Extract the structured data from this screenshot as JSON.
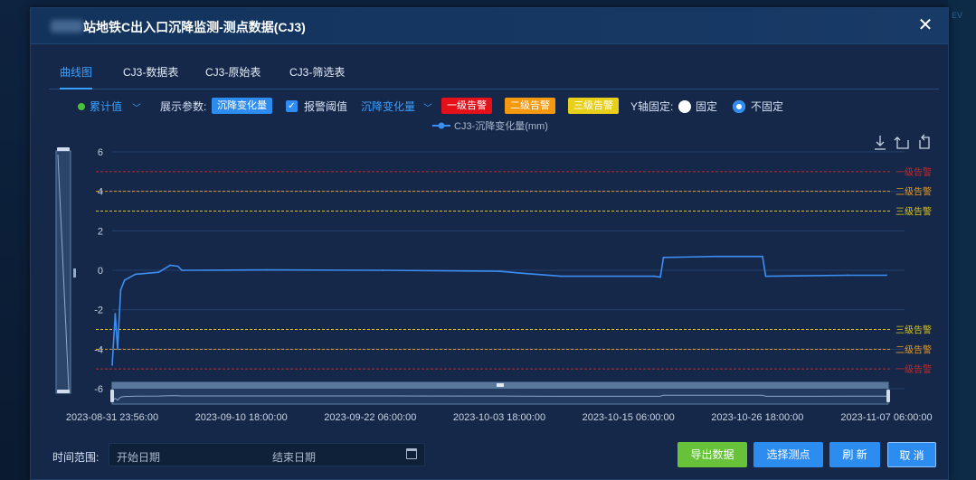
{
  "background": {
    "corner_text": "EV"
  },
  "dialog": {
    "title": "站地铁C出入口沉降监测-测点数据(CJ3)",
    "close_glyph": "✕"
  },
  "tabs": [
    {
      "label": "曲线图",
      "active": true
    },
    {
      "label": "CJ3-数据表",
      "active": false
    },
    {
      "label": "CJ3-原始表",
      "active": false
    },
    {
      "label": "CJ3-筛选表",
      "active": false
    }
  ],
  "toolbar": {
    "value_select": "累计值",
    "display_param_label": "展示参数:",
    "display_param_value": "沉降变化量",
    "alarm_checkbox_label": "报警阈值",
    "alarm_select": "沉降变化量",
    "alarm_tags": [
      {
        "label": "一级告警",
        "color": "#e5111a"
      },
      {
        "label": "二级告警",
        "color": "#f59a0e"
      },
      {
        "label": "三级告警",
        "color": "#e8d01a"
      }
    ],
    "y_axis_label": "Y轴固定:",
    "radio_fixed": "固定",
    "radio_not_fixed": "不固定"
  },
  "chart_data": {
    "type": "line",
    "legend": "CJ3-沉降变化量(mm)",
    "y_ticks": [
      "6",
      "4",
      "2",
      "0",
      "-2",
      "-4",
      "-6"
    ],
    "ylim": [
      -6,
      6
    ],
    "x_tick_labels": [
      "2023-08-31 23:56:00",
      "2023-09-10 18:00:00",
      "2023-09-22 06:00:00",
      "2023-10-03 18:00:00",
      "2023-10-15 06:00:00",
      "2023-10-26 18:00:00",
      "2023-11-07 06:00:00"
    ],
    "thresholds": [
      {
        "label": "一级告警",
        "value": 5,
        "color": "#c22a2a"
      },
      {
        "label": "二级告警",
        "value": 4,
        "color": "#e39a21"
      },
      {
        "label": "三级告警",
        "value": 3,
        "color": "#d8c21a"
      },
      {
        "label": "三级告警",
        "value": -3,
        "color": "#d8c21a"
      },
      {
        "label": "二级告警",
        "value": -4,
        "color": "#e39a21"
      },
      {
        "label": "一级告警",
        "value": -5,
        "color": "#c22a2a"
      }
    ],
    "series": [
      {
        "name": "CJ3-沉降变化量(mm)",
        "color": "#3d8ef2",
        "points": [
          [
            0,
            -4.8
          ],
          [
            0.004,
            -2.2
          ],
          [
            0.007,
            -4.0
          ],
          [
            0.011,
            -1.0
          ],
          [
            0.016,
            -0.5
          ],
          [
            0.03,
            -0.2
          ],
          [
            0.06,
            -0.1
          ],
          [
            0.075,
            0.25
          ],
          [
            0.085,
            0.2
          ],
          [
            0.09,
            0.0
          ],
          [
            0.2,
            0.02
          ],
          [
            0.35,
            0.0
          ],
          [
            0.5,
            -0.05
          ],
          [
            0.53,
            -0.15
          ],
          [
            0.58,
            -0.3
          ],
          [
            0.7,
            -0.3
          ],
          [
            0.708,
            -0.35
          ],
          [
            0.712,
            0.65
          ],
          [
            0.78,
            0.7
          ],
          [
            0.84,
            0.7
          ],
          [
            0.844,
            -0.3
          ],
          [
            0.95,
            -0.25
          ],
          [
            1.0,
            -0.25
          ]
        ]
      }
    ],
    "grid": true
  },
  "footer": {
    "time_range_label": "时间范围:",
    "start_placeholder": "开始日期",
    "end_placeholder": "结束日期",
    "buttons": [
      {
        "label": "导出数据",
        "color": "#67c23a"
      },
      {
        "label": "选择测点",
        "color": "#2d8cf0"
      },
      {
        "label": "刷 新",
        "color": "#2d8cf0"
      },
      {
        "label": "取 消",
        "color": "#2d8cf0"
      }
    ]
  }
}
